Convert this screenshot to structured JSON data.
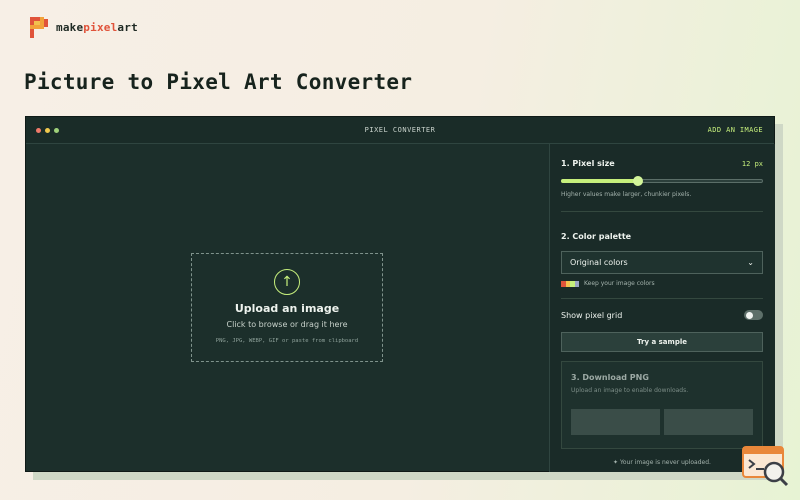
{
  "brand": {
    "prefix": "make",
    "accent": "pixel",
    "suffix": "art"
  },
  "page": {
    "title": "Picture to Pixel Art Converter"
  },
  "window": {
    "title": "PIXEL CONVERTER",
    "add_image_label": "ADD AN IMAGE"
  },
  "upload": {
    "title": "Upload an image",
    "subtitle": "Click to browse or drag it here",
    "hint": "PNG, JPG, WEBP, GIF or paste from clipboard",
    "icon": "arrow-up-icon"
  },
  "pixel_size": {
    "title": "1. Pixel size",
    "value_label": "12 px",
    "slider_fraction": 0.38,
    "helper": "Higher values make larger, chunkier pixels."
  },
  "palette": {
    "title": "2. Color palette",
    "selected": "Original colors",
    "note": "Keep your image colors",
    "swatch_colors": [
      "#e0533a",
      "#f2c14e",
      "#c6ef7c",
      "#9aa5c4"
    ]
  },
  "pixel_grid": {
    "label": "Show pixel grid",
    "enabled": false
  },
  "sample": {
    "label": "Try a sample"
  },
  "download": {
    "title": "3. Download PNG",
    "subtitle": "Upload an image to enable downloads."
  },
  "privacy": {
    "text": "✦ Your image is never uploaded."
  },
  "colors": {
    "accent": "#c6ef7c",
    "window_bg": "#1c2f2b",
    "dot_red": "#f07a6a",
    "dot_yellow": "#f0c94e",
    "dot_green": "#9fd17a"
  }
}
